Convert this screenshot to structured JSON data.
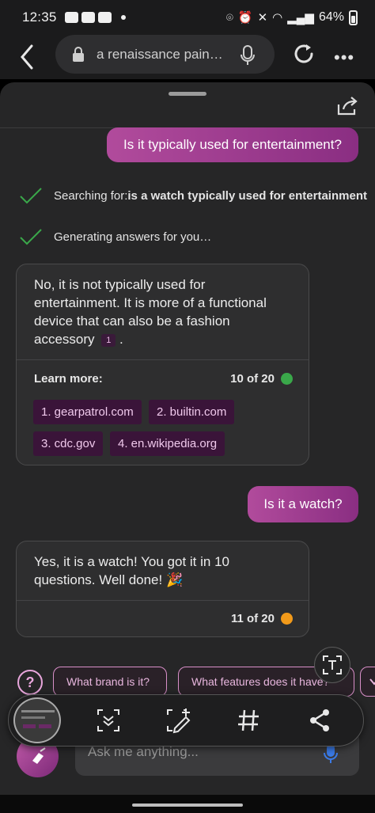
{
  "status_bar": {
    "time": "12:35",
    "battery_text": "64%"
  },
  "browser": {
    "url_text": "a renaissance paint…"
  },
  "chat": {
    "messages": [
      {
        "role": "user",
        "text": "Is it typically used for entertainment?"
      },
      {
        "role": "status",
        "prefix": "Searching for: ",
        "bold": "is a watch typically used for entertainment"
      },
      {
        "role": "status",
        "prefix": "Generating answers for you…"
      },
      {
        "role": "assistant",
        "text": "No, it is not typically used for entertainment. It is more of a functional device that can also be a fashion accessory",
        "citation": "1",
        "trail": ".",
        "learn_more_label": "Learn more:",
        "counter": "10 of 20",
        "counter_color": "#3aa84a",
        "sources": [
          "1. gearpatrol.com",
          "2. builtin.com",
          "3. cdc.gov",
          "4. en.wikipedia.org"
        ]
      },
      {
        "role": "user",
        "text": "Is it a watch?"
      },
      {
        "role": "assistant",
        "text": "Yes, it is a watch! You got it in 10 questions. Well done! 🎉",
        "counter": "11 of 20",
        "counter_color": "#f29a1a"
      }
    ]
  },
  "suggestions": {
    "help_icon": "?",
    "items": [
      "What brand is it?",
      "What features does it have?"
    ]
  },
  "composer": {
    "placeholder": "Ask me anything..."
  },
  "colors": {
    "accent": "#a13b93",
    "chip_bg": "#3a1439"
  }
}
